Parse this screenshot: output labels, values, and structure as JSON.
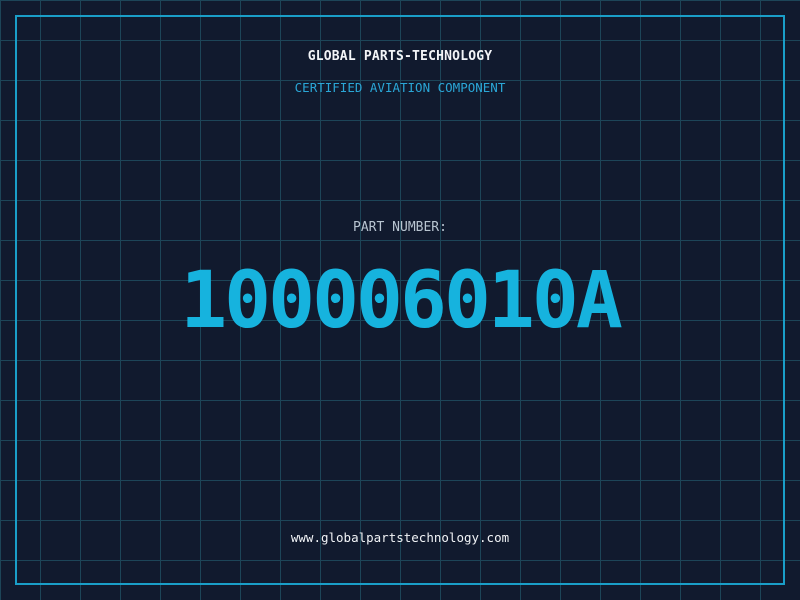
{
  "header": {
    "company": "GLOBAL PARTS-TECHNOLOGY",
    "subtitle": "CERTIFIED AVIATION COMPONENT"
  },
  "part": {
    "label": "PART NUMBER:",
    "number": "100006010A"
  },
  "footer": {
    "website": "www.globalpartstechnology.com"
  },
  "colors": {
    "background": "#111a2e",
    "grid": "#1d4558",
    "frame": "#1a9ec8",
    "accent": "#16b3de",
    "text": "#f2f4f7"
  }
}
